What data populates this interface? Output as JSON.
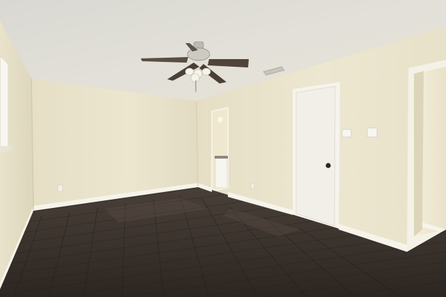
{
  "scene": {
    "room": "empty-bedroom",
    "ceiling_fixture": "ceiling-fan-with-light",
    "floor": "dark-wood-plank"
  },
  "colors": {
    "ceiling": "#dcdad2",
    "wall_light": "#efe9d3",
    "wall_mid": "#e6dfc6",
    "wall_shadow": "#d6cfb6",
    "trim": "#f4f1e8",
    "door": "#f2f0ea",
    "floor_dark": "#2e2823",
    "floor_mid": "#4a3f37"
  }
}
